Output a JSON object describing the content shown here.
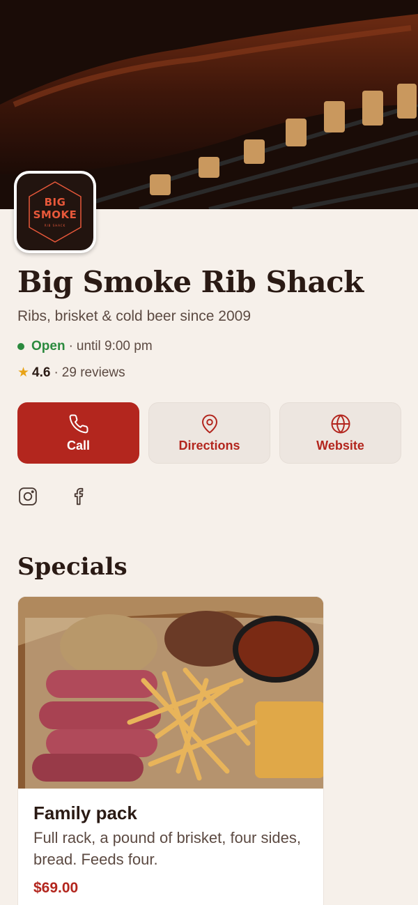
{
  "business": {
    "logo_line1": "BIG",
    "logo_line2": "SMOKE",
    "logo_line3": "RIB SHACK",
    "name": "Big Smoke Rib Shack",
    "tagline": "Ribs, brisket & cold beer since 2009"
  },
  "status": {
    "open_label": "Open",
    "separator": "·",
    "hours": "until 9:00 pm"
  },
  "rating": {
    "star": "★",
    "score": "4.6",
    "separator": "·",
    "reviews": "29 reviews"
  },
  "actions": [
    {
      "label": "Call",
      "icon": "phone-icon"
    },
    {
      "label": "Directions",
      "icon": "map-pin-icon"
    },
    {
      "label": "Website",
      "icon": "globe-icon"
    }
  ],
  "socials": [
    {
      "icon": "instagram-icon"
    },
    {
      "icon": "facebook-icon"
    }
  ],
  "specials": {
    "title": "Specials",
    "items": [
      {
        "title": "Family pack",
        "description": "Full rack, a pound of brisket, four sides, bread. Feeds four.",
        "price": "$69.00"
      }
    ]
  },
  "colors": {
    "accent": "#b3261e",
    "open": "#2b8a3e",
    "star": "#e8a317",
    "background": "#f6f0ea"
  }
}
